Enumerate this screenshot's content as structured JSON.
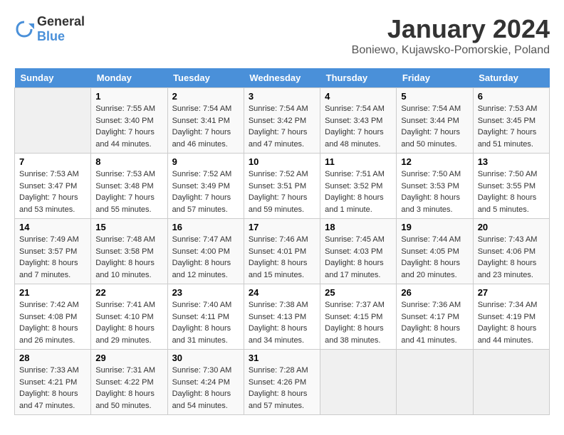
{
  "header": {
    "logo_general": "General",
    "logo_blue": "Blue",
    "month_title": "January 2024",
    "location": "Boniewo, Kujawsko-Pomorskie, Poland"
  },
  "days_of_week": [
    "Sunday",
    "Monday",
    "Tuesday",
    "Wednesday",
    "Thursday",
    "Friday",
    "Saturday"
  ],
  "weeks": [
    [
      {
        "day": "",
        "sunrise": "",
        "sunset": "",
        "daylight": ""
      },
      {
        "day": "1",
        "sunrise": "Sunrise: 7:55 AM",
        "sunset": "Sunset: 3:40 PM",
        "daylight": "Daylight: 7 hours and 44 minutes."
      },
      {
        "day": "2",
        "sunrise": "Sunrise: 7:54 AM",
        "sunset": "Sunset: 3:41 PM",
        "daylight": "Daylight: 7 hours and 46 minutes."
      },
      {
        "day": "3",
        "sunrise": "Sunrise: 7:54 AM",
        "sunset": "Sunset: 3:42 PM",
        "daylight": "Daylight: 7 hours and 47 minutes."
      },
      {
        "day": "4",
        "sunrise": "Sunrise: 7:54 AM",
        "sunset": "Sunset: 3:43 PM",
        "daylight": "Daylight: 7 hours and 48 minutes."
      },
      {
        "day": "5",
        "sunrise": "Sunrise: 7:54 AM",
        "sunset": "Sunset: 3:44 PM",
        "daylight": "Daylight: 7 hours and 50 minutes."
      },
      {
        "day": "6",
        "sunrise": "Sunrise: 7:53 AM",
        "sunset": "Sunset: 3:45 PM",
        "daylight": "Daylight: 7 hours and 51 minutes."
      }
    ],
    [
      {
        "day": "7",
        "sunrise": "Sunrise: 7:53 AM",
        "sunset": "Sunset: 3:47 PM",
        "daylight": "Daylight: 7 hours and 53 minutes."
      },
      {
        "day": "8",
        "sunrise": "Sunrise: 7:53 AM",
        "sunset": "Sunset: 3:48 PM",
        "daylight": "Daylight: 7 hours and 55 minutes."
      },
      {
        "day": "9",
        "sunrise": "Sunrise: 7:52 AM",
        "sunset": "Sunset: 3:49 PM",
        "daylight": "Daylight: 7 hours and 57 minutes."
      },
      {
        "day": "10",
        "sunrise": "Sunrise: 7:52 AM",
        "sunset": "Sunset: 3:51 PM",
        "daylight": "Daylight: 7 hours and 59 minutes."
      },
      {
        "day": "11",
        "sunrise": "Sunrise: 7:51 AM",
        "sunset": "Sunset: 3:52 PM",
        "daylight": "Daylight: 8 hours and 1 minute."
      },
      {
        "day": "12",
        "sunrise": "Sunrise: 7:50 AM",
        "sunset": "Sunset: 3:53 PM",
        "daylight": "Daylight: 8 hours and 3 minutes."
      },
      {
        "day": "13",
        "sunrise": "Sunrise: 7:50 AM",
        "sunset": "Sunset: 3:55 PM",
        "daylight": "Daylight: 8 hours and 5 minutes."
      }
    ],
    [
      {
        "day": "14",
        "sunrise": "Sunrise: 7:49 AM",
        "sunset": "Sunset: 3:57 PM",
        "daylight": "Daylight: 8 hours and 7 minutes."
      },
      {
        "day": "15",
        "sunrise": "Sunrise: 7:48 AM",
        "sunset": "Sunset: 3:58 PM",
        "daylight": "Daylight: 8 hours and 10 minutes."
      },
      {
        "day": "16",
        "sunrise": "Sunrise: 7:47 AM",
        "sunset": "Sunset: 4:00 PM",
        "daylight": "Daylight: 8 hours and 12 minutes."
      },
      {
        "day": "17",
        "sunrise": "Sunrise: 7:46 AM",
        "sunset": "Sunset: 4:01 PM",
        "daylight": "Daylight: 8 hours and 15 minutes."
      },
      {
        "day": "18",
        "sunrise": "Sunrise: 7:45 AM",
        "sunset": "Sunset: 4:03 PM",
        "daylight": "Daylight: 8 hours and 17 minutes."
      },
      {
        "day": "19",
        "sunrise": "Sunrise: 7:44 AM",
        "sunset": "Sunset: 4:05 PM",
        "daylight": "Daylight: 8 hours and 20 minutes."
      },
      {
        "day": "20",
        "sunrise": "Sunrise: 7:43 AM",
        "sunset": "Sunset: 4:06 PM",
        "daylight": "Daylight: 8 hours and 23 minutes."
      }
    ],
    [
      {
        "day": "21",
        "sunrise": "Sunrise: 7:42 AM",
        "sunset": "Sunset: 4:08 PM",
        "daylight": "Daylight: 8 hours and 26 minutes."
      },
      {
        "day": "22",
        "sunrise": "Sunrise: 7:41 AM",
        "sunset": "Sunset: 4:10 PM",
        "daylight": "Daylight: 8 hours and 29 minutes."
      },
      {
        "day": "23",
        "sunrise": "Sunrise: 7:40 AM",
        "sunset": "Sunset: 4:11 PM",
        "daylight": "Daylight: 8 hours and 31 minutes."
      },
      {
        "day": "24",
        "sunrise": "Sunrise: 7:38 AM",
        "sunset": "Sunset: 4:13 PM",
        "daylight": "Daylight: 8 hours and 34 minutes."
      },
      {
        "day": "25",
        "sunrise": "Sunrise: 7:37 AM",
        "sunset": "Sunset: 4:15 PM",
        "daylight": "Daylight: 8 hours and 38 minutes."
      },
      {
        "day": "26",
        "sunrise": "Sunrise: 7:36 AM",
        "sunset": "Sunset: 4:17 PM",
        "daylight": "Daylight: 8 hours and 41 minutes."
      },
      {
        "day": "27",
        "sunrise": "Sunrise: 7:34 AM",
        "sunset": "Sunset: 4:19 PM",
        "daylight": "Daylight: 8 hours and 44 minutes."
      }
    ],
    [
      {
        "day": "28",
        "sunrise": "Sunrise: 7:33 AM",
        "sunset": "Sunset: 4:21 PM",
        "daylight": "Daylight: 8 hours and 47 minutes."
      },
      {
        "day": "29",
        "sunrise": "Sunrise: 7:31 AM",
        "sunset": "Sunset: 4:22 PM",
        "daylight": "Daylight: 8 hours and 50 minutes."
      },
      {
        "day": "30",
        "sunrise": "Sunrise: 7:30 AM",
        "sunset": "Sunset: 4:24 PM",
        "daylight": "Daylight: 8 hours and 54 minutes."
      },
      {
        "day": "31",
        "sunrise": "Sunrise: 7:28 AM",
        "sunset": "Sunset: 4:26 PM",
        "daylight": "Daylight: 8 hours and 57 minutes."
      },
      {
        "day": "",
        "sunrise": "",
        "sunset": "",
        "daylight": ""
      },
      {
        "day": "",
        "sunrise": "",
        "sunset": "",
        "daylight": ""
      },
      {
        "day": "",
        "sunrise": "",
        "sunset": "",
        "daylight": ""
      }
    ]
  ]
}
